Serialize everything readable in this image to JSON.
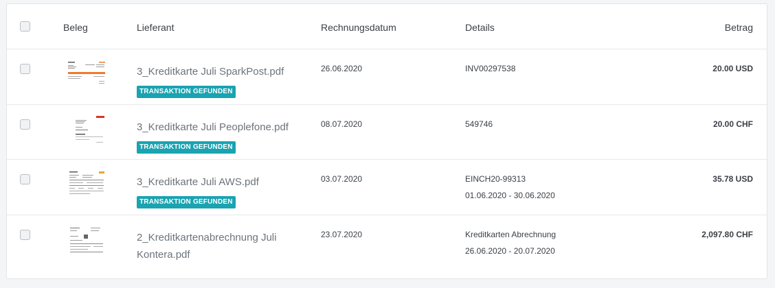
{
  "table": {
    "headers": {
      "beleg": "Beleg",
      "lieferant": "Lieferant",
      "rechnungsdatum": "Rechnungsdatum",
      "details": "Details",
      "betrag": "Betrag"
    },
    "rows": [
      {
        "filename": "3_Kreditkarte Juli SparkPost.pdf",
        "badge": "TRANSAKTION GEFUNDEN",
        "date": "26.06.2020",
        "details": "INV00297538",
        "details_sub": "",
        "amount": "20.00 USD"
      },
      {
        "filename": "3_Kreditkarte Juli Peoplefone.pdf",
        "badge": "TRANSAKTION GEFUNDEN",
        "date": "08.07.2020",
        "details": "549746",
        "details_sub": "",
        "amount": "20.00 CHF"
      },
      {
        "filename": "3_Kreditkarte Juli AWS.pdf",
        "badge": "TRANSAKTION GEFUNDEN",
        "date": "03.07.2020",
        "details": "EINCH20-99313",
        "details_sub": "01.06.2020 - 30.06.2020",
        "amount": "35.78 USD"
      },
      {
        "filename": "2_Kreditkartenabrechnung Juli Kontera.pdf",
        "badge": "",
        "date": "23.07.2020",
        "details": "Kreditkarten Abrechnung",
        "details_sub": "26.06.2020 - 20.07.2020",
        "amount": "2,097.80 CHF"
      }
    ]
  },
  "colors": {
    "badge": "#1aa3b1",
    "filename": "#6d737a",
    "border": "#e6e8eb"
  }
}
